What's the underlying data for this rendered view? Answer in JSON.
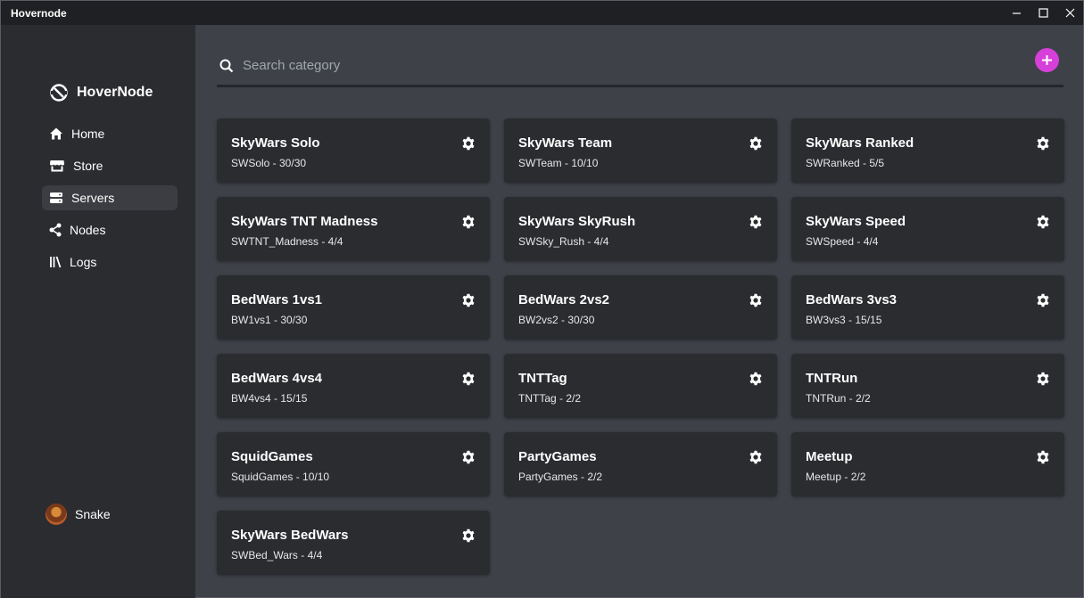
{
  "window": {
    "title": "Hovernode"
  },
  "sidebar": {
    "brand": "HoverNode",
    "items": [
      {
        "label": "Home",
        "icon": "home-icon",
        "active": false
      },
      {
        "label": "Store",
        "icon": "store-icon",
        "active": false
      },
      {
        "label": "Servers",
        "icon": "servers-icon",
        "active": true
      },
      {
        "label": "Nodes",
        "icon": "nodes-icon",
        "active": false
      },
      {
        "label": "Logs",
        "icon": "logs-icon",
        "active": false
      }
    ],
    "user": {
      "name": "Snake"
    }
  },
  "search": {
    "placeholder": "Search category",
    "value": ""
  },
  "colors": {
    "accent": "#d63fd9",
    "sidebar": "#2b2c30",
    "card": "#2b2c30",
    "main": "#3e4148"
  },
  "categories": [
    {
      "name": "SkyWars Solo",
      "info": "SWSolo - 30/30"
    },
    {
      "name": "SkyWars Team",
      "info": "SWTeam - 10/10"
    },
    {
      "name": "SkyWars Ranked",
      "info": "SWRanked - 5/5"
    },
    {
      "name": "SkyWars TNT Madness",
      "info": "SWTNT_Madness - 4/4"
    },
    {
      "name": "SkyWars SkyRush",
      "info": "SWSky_Rush - 4/4"
    },
    {
      "name": "SkyWars Speed",
      "info": "SWSpeed - 4/4"
    },
    {
      "name": "BedWars 1vs1",
      "info": "BW1vs1 - 30/30"
    },
    {
      "name": "BedWars 2vs2",
      "info": "BW2vs2 - 30/30"
    },
    {
      "name": "BedWars 3vs3",
      "info": "BW3vs3 - 15/15"
    },
    {
      "name": "BedWars 4vs4",
      "info": "BW4vs4 - 15/15"
    },
    {
      "name": "TNTTag",
      "info": "TNTTag - 2/2"
    },
    {
      "name": "TNTRun",
      "info": "TNTRun - 2/2"
    },
    {
      "name": "SquidGames",
      "info": "SquidGames - 10/10"
    },
    {
      "name": "PartyGames",
      "info": "PartyGames - 2/2"
    },
    {
      "name": "Meetup",
      "info": "Meetup - 2/2"
    },
    {
      "name": "SkyWars BedWars",
      "info": "SWBed_Wars - 4/4"
    }
  ]
}
